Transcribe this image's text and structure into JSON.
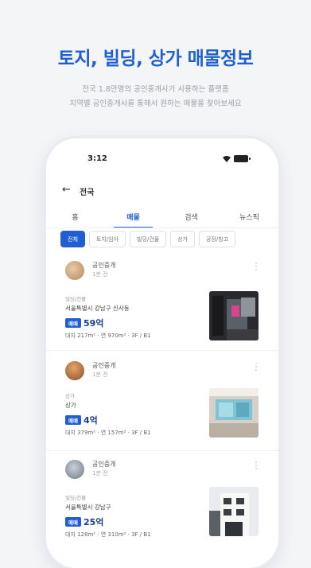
{
  "headline": "토지, 빌딩, 상가 매물정보",
  "subline_1": "전국 1.8만명의 공인중개사가 사용하는 플랫폼",
  "subline_2": "지역별 공인중개사를 통해서 원하는 매물을 찾아보세요",
  "status_bar": {
    "time": "3:12"
  },
  "nav": {
    "title": "전국"
  },
  "tabs": [
    "홈",
    "매물",
    "검색",
    "뉴스픽"
  ],
  "active_tab_index": 1,
  "chips": [
    "전체",
    "토지/임야",
    "빌딩/건물",
    "상가",
    "공장/창고"
  ],
  "active_chip_index": 0,
  "listings": [
    {
      "agent_name": "공인중개",
      "agent_time": "1분 전",
      "category": "빌딩/건물",
      "address": "서울특별시 강남구 신사동",
      "deal_type": "매매",
      "price": "59억",
      "specs": "대지 217m² · 연 970m² · 3F / B1"
    },
    {
      "agent_name": "공인중개",
      "agent_time": "1분 전",
      "category": "상가",
      "address": "상가",
      "deal_type": "매매",
      "price": "4억",
      "specs": "대지 379m² · 연 157m² · 3F / B1"
    },
    {
      "agent_name": "공인중개",
      "agent_time": "1분 전",
      "category": "빌딩/건물",
      "address": "서울특별시 강남구",
      "deal_type": "매매",
      "price": "25억",
      "specs": "대지 128m² · 연 310m² · 3F / B1"
    }
  ],
  "colors": {
    "brand": "#1f5fd1",
    "background": "#f4f5f7"
  }
}
